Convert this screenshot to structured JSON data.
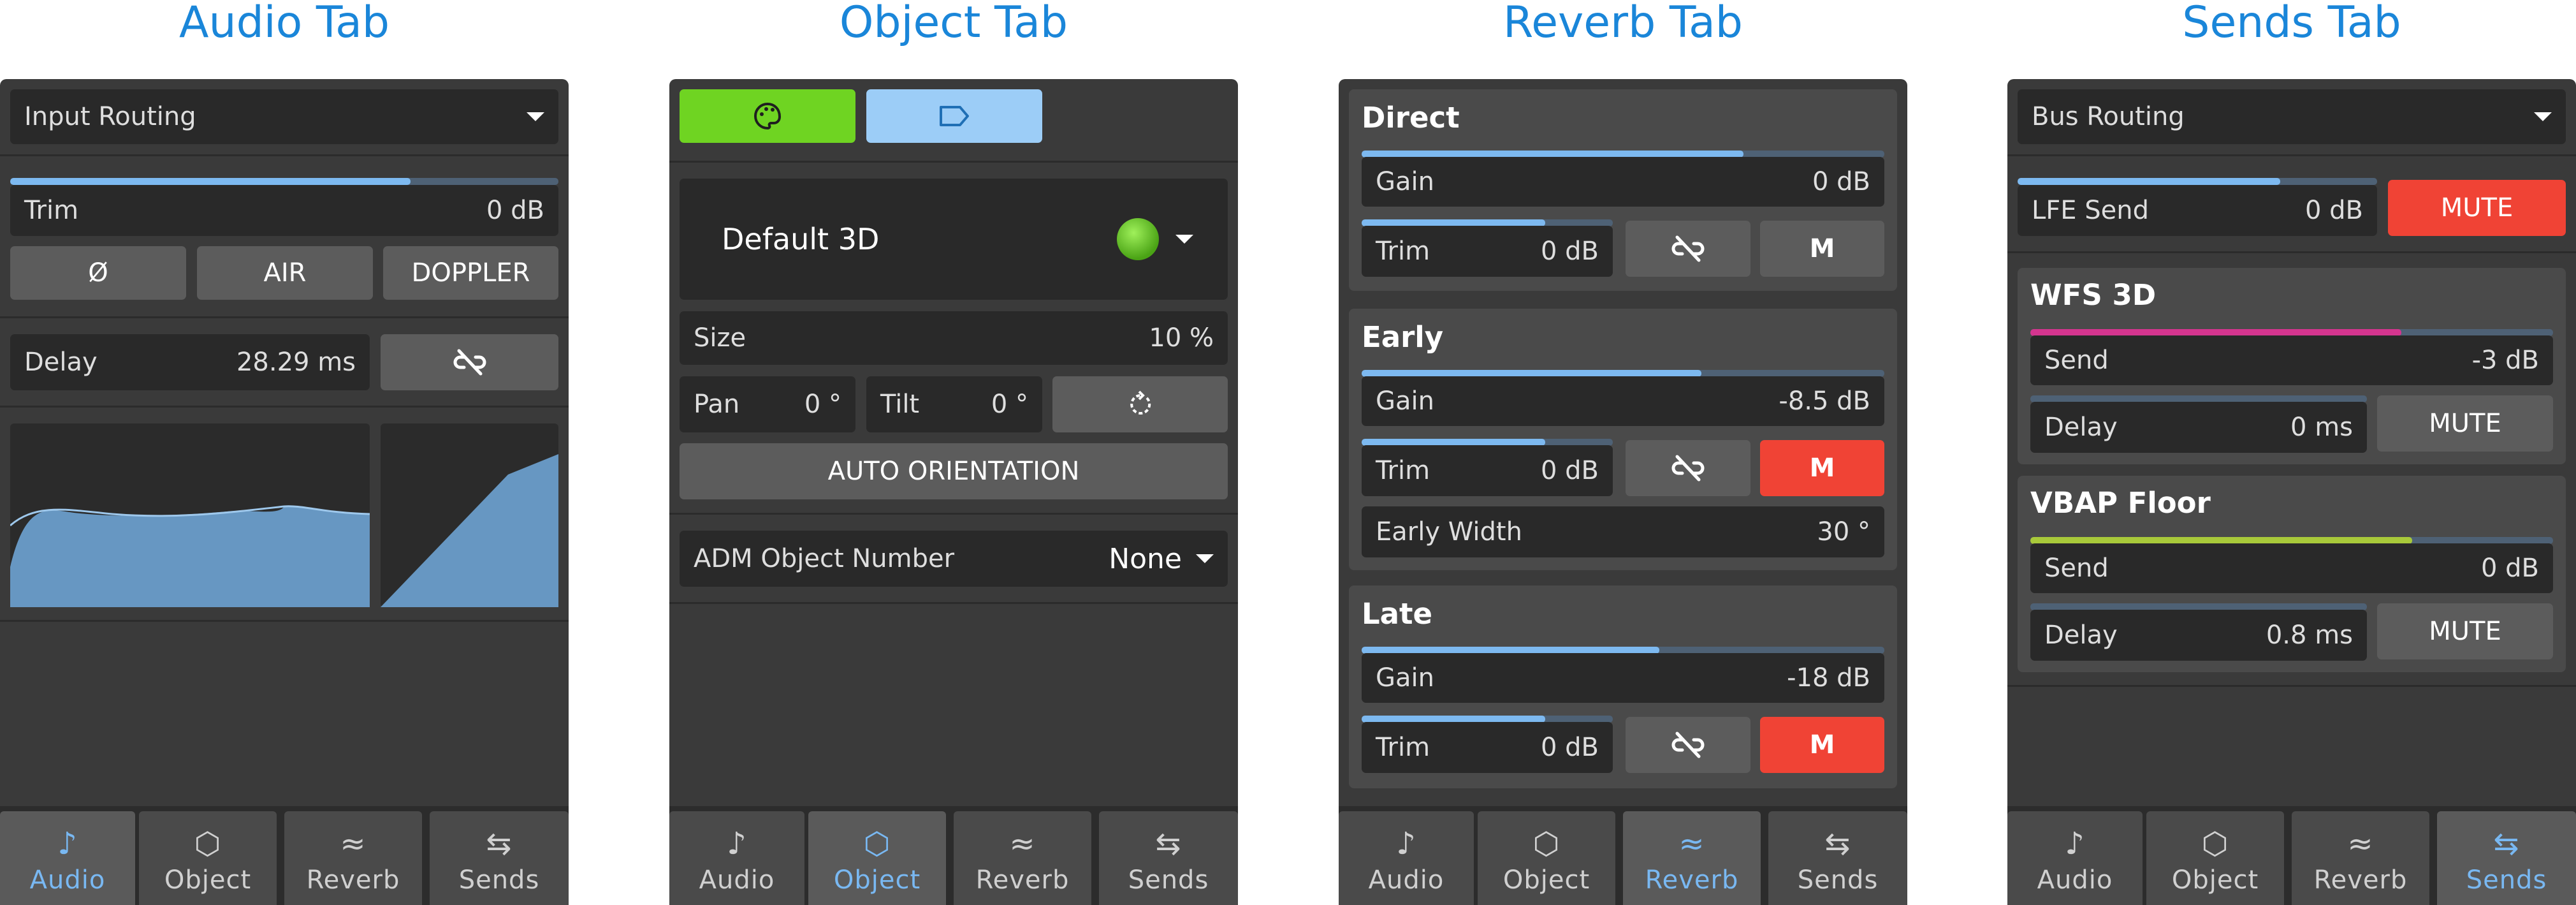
{
  "titles": {
    "audio": "Audio Tab",
    "object": "Object Tab",
    "reverb": "Reverb Tab",
    "sends": "Sends Tab"
  },
  "colors": {
    "accent_blue": "#7db9f0",
    "mute_red": "#f04335",
    "palette_green": "#6fd422",
    "label_blue": "#9ccdf7",
    "wfs_magenta": "#d5358f",
    "vbap_yellow_green": "#a8c93a",
    "title_blue": "#1a86d9"
  },
  "nav": {
    "tabs": [
      {
        "label": "Audio",
        "icon": "music-note-icon"
      },
      {
        "label": "Object",
        "icon": "cube-icon"
      },
      {
        "label": "Reverb",
        "icon": "reverb-icon"
      },
      {
        "label": "Sends",
        "icon": "sends-arrow-icon"
      }
    ]
  },
  "audio": {
    "routing_label": "Input Routing",
    "trim_label": "Trim",
    "trim_value": "0 dB",
    "trim_meter": 0.73,
    "phase_label": "Ø",
    "air_label": "AIR",
    "doppler_label": "DOPPLER",
    "delay_label": "Delay",
    "delay_value": "28.29 ms",
    "link_icon": "link-off-icon",
    "active_tab": 0
  },
  "object": {
    "palette_icon": "palette-icon",
    "label_icon": "label-tag-icon",
    "preset_label": "Default 3D",
    "size_label": "Size",
    "size_value": "10 %",
    "pan_label": "Pan",
    "pan_value": "0 °",
    "tilt_label": "Tilt",
    "tilt_value": "0 °",
    "reset_icon": "rotate-reset-icon",
    "auto_orientation_label": "AUTO ORIENTATION",
    "adm_label": "ADM Object Number",
    "adm_value": "None",
    "active_tab": 1
  },
  "reverb": {
    "direct": {
      "header": "Direct",
      "gain_label": "Gain",
      "gain_value": "0 dB",
      "gain_meter": 0.73,
      "trim_label": "Trim",
      "trim_value": "0 dB",
      "trim_meter": 0.73,
      "mute_label": "M",
      "mute_active": false
    },
    "early": {
      "header": "Early",
      "gain_label": "Gain",
      "gain_value": "-8.5 dB",
      "gain_meter": 0.65,
      "trim_label": "Trim",
      "trim_value": "0 dB",
      "trim_meter": 0.73,
      "mute_label": "M",
      "mute_active": true,
      "width_label": "Early Width",
      "width_value": "30 °"
    },
    "late": {
      "header": "Late",
      "gain_label": "Gain",
      "gain_value": "-18 dB",
      "gain_meter": 0.57,
      "trim_label": "Trim",
      "trim_value": "0 dB",
      "trim_meter": 0.73,
      "mute_label": "M",
      "mute_active": true
    },
    "active_tab": 2
  },
  "sends": {
    "routing_label": "Bus Routing",
    "lfe_label": "LFE Send",
    "lfe_value": "0 dB",
    "lfe_meter": 0.73,
    "lfe_mute_label": "MUTE",
    "lfe_mute_active": true,
    "wfs": {
      "header": "WFS 3D",
      "send_label": "Send",
      "send_value": "-3 dB",
      "send_meter": 0.71,
      "delay_label": "Delay",
      "delay_value": "0 ms",
      "mute_label": "MUTE"
    },
    "vbap": {
      "header": "VBAP Floor",
      "send_label": "Send",
      "send_value": "0 dB",
      "send_meter": 0.73,
      "delay_label": "Delay",
      "delay_value": "0.8 ms",
      "mute_label": "MUTE"
    },
    "active_tab": 3
  }
}
